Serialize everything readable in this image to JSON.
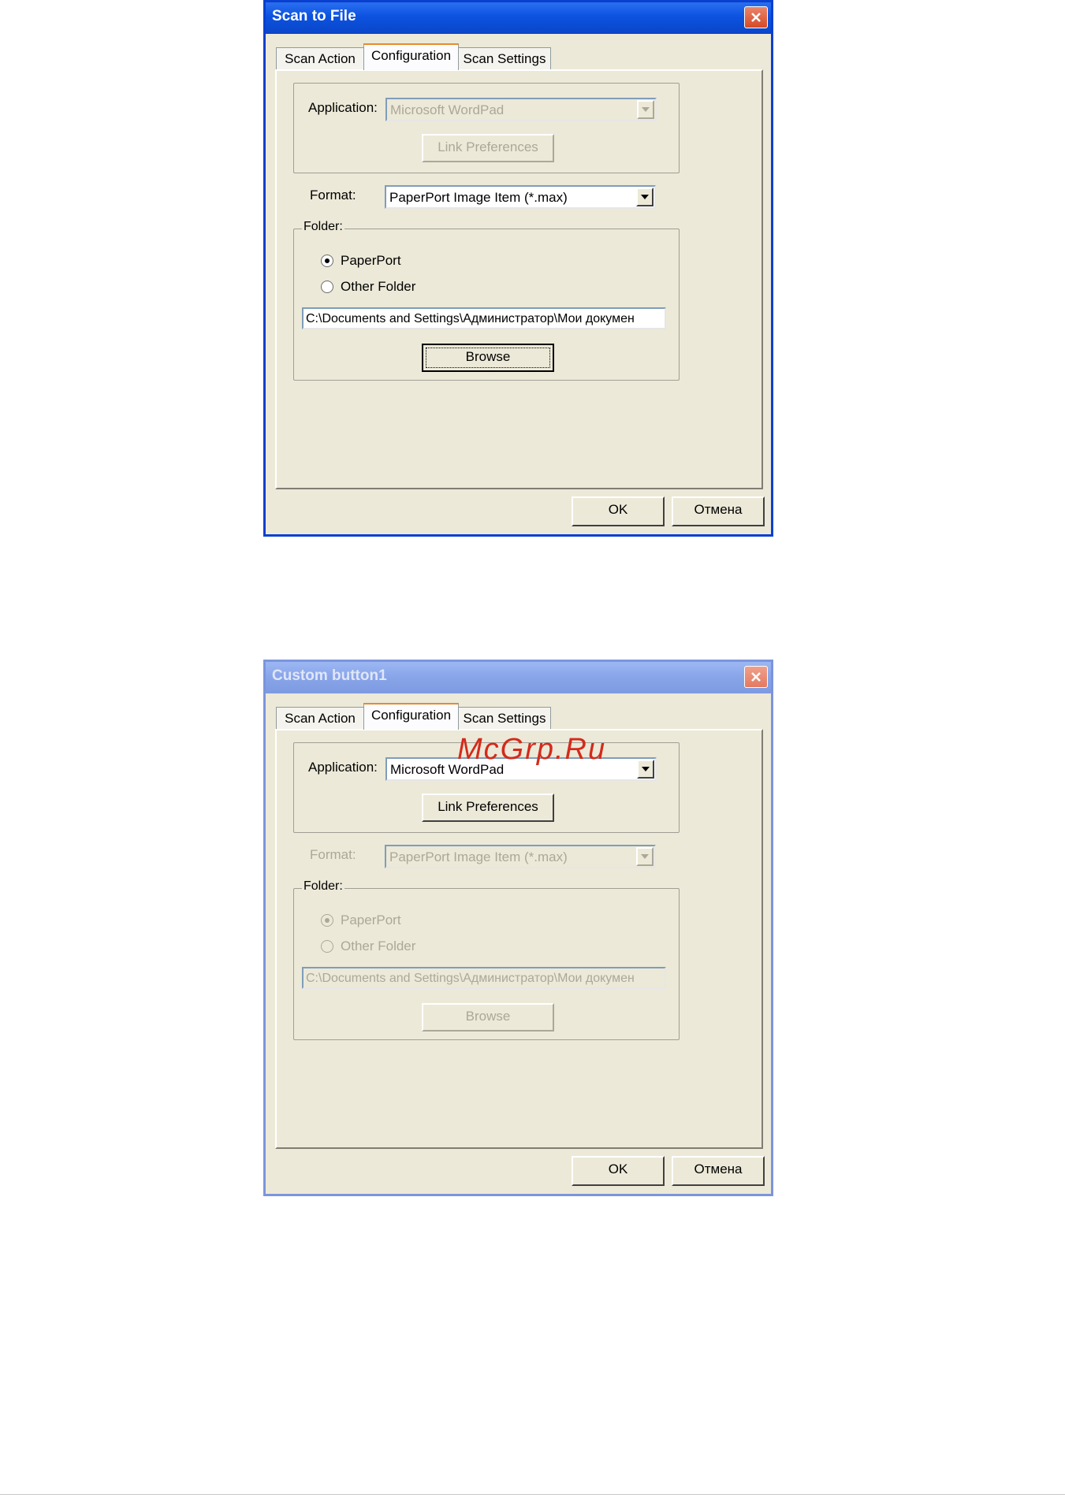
{
  "dialogs": [
    {
      "title": "Scan to File",
      "tabs": [
        "Scan Action",
        "Configuration",
        "Scan Settings"
      ],
      "application_label": "Application:",
      "application_value": "Microsoft WordPad",
      "link_preferences": "Link Preferences",
      "format_label": "Format:",
      "format_value": "PaperPort Image Item (*.max)",
      "folder_legend": "Folder:",
      "radio_paperport": "PaperPort",
      "radio_other": "Other Folder",
      "path": "C:\\Documents and Settings\\Администратор\\Мои докумен",
      "browse": "Browse",
      "ok": "OK",
      "cancel": "Отмена"
    },
    {
      "title": "Custom button1",
      "tabs": [
        "Scan Action",
        "Configuration",
        "Scan Settings"
      ],
      "application_label": "Application:",
      "application_value": "Microsoft WordPad",
      "link_preferences": "Link Preferences",
      "format_label": "Format:",
      "format_value": "PaperPort Image Item (*.max)",
      "folder_legend": "Folder:",
      "radio_paperport": "PaperPort",
      "radio_other": "Other Folder",
      "path": "C:\\Documents and Settings\\Администратор\\Мои докумен",
      "browse": "Browse",
      "ok": "OK",
      "cancel": "Отмена"
    }
  ],
  "watermark": "McGrp.Ru",
  "icons": {
    "close": "close-icon",
    "dropdown": "chevron-down-icon"
  },
  "colors": {
    "dialog_bg": "#ece9d8",
    "titlebar_active": "#0a46c8",
    "titlebar_inactive": "#7d99e0",
    "close_button": "#d64a26",
    "watermark": "#d42a1b"
  }
}
